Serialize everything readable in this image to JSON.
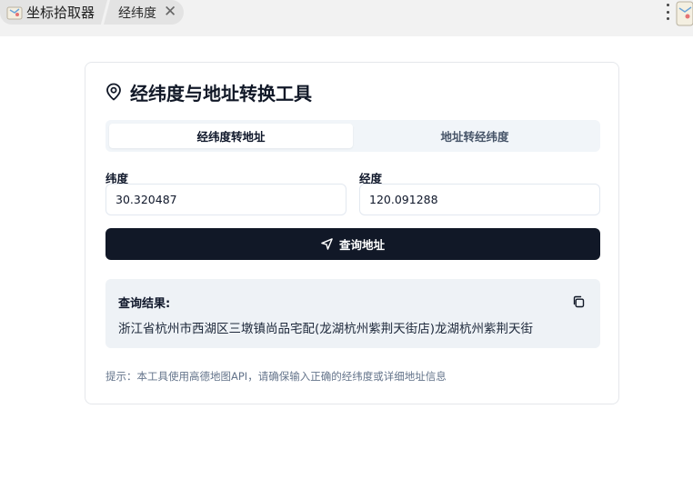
{
  "browser": {
    "app_tab_label": "坐标拾取器",
    "page_tab_label": "经纬度",
    "close_glyph": "✕"
  },
  "card": {
    "title": "经纬度与地址转换工具"
  },
  "mode_tabs": [
    {
      "label": "经纬度转地址",
      "active": true
    },
    {
      "label": "地址转经纬度",
      "active": false
    }
  ],
  "form": {
    "latitude_label": "纬度",
    "latitude_value": "30.320487",
    "longitude_label": "经度",
    "longitude_value": "120.091288",
    "query_button_label": "查询地址"
  },
  "result": {
    "title": "查询结果:",
    "text": "浙江省杭州市西湖区三墩镇尚品宅配(龙湖杭州紫荆天街店)龙湖杭州紫荆天街"
  },
  "hint": "提示：本工具使用高德地图API，请确保输入正确的经纬度或详细地址信息",
  "icons": {
    "title_icon": "map-pin-icon",
    "button_icon": "navigation-arrow-icon",
    "copy_icon": "copy-icon"
  },
  "colors": {
    "primary_button": "#111827",
    "result_bg": "#eef2f6",
    "segment_bg": "#f1f5f9"
  }
}
